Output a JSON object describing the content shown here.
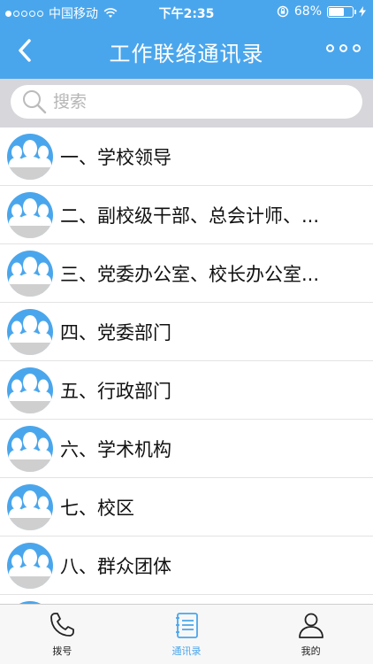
{
  "status_bar": {
    "carrier": "中国移动",
    "time": "下午2:35",
    "battery_text": "68%",
    "battery_level": 0.68
  },
  "nav": {
    "title": "工作联络通讯录"
  },
  "search": {
    "placeholder": "搜索"
  },
  "list": {
    "items": [
      {
        "label": "一、学校领导"
      },
      {
        "label": "二、副校级干部、总会计师、..."
      },
      {
        "label": "三、党委办公室、校长办公室..."
      },
      {
        "label": "四、党委部门"
      },
      {
        "label": "五、行政部门"
      },
      {
        "label": "六、学术机构"
      },
      {
        "label": "七、校区"
      },
      {
        "label": "八、群众团体"
      },
      {
        "label": ""
      }
    ]
  },
  "tabbar": {
    "tabs": [
      {
        "label": "拨号",
        "icon": "phone-icon",
        "active": false
      },
      {
        "label": "通讯录",
        "icon": "contacts-book-icon",
        "active": true
      },
      {
        "label": "我的",
        "icon": "person-icon",
        "active": false
      }
    ]
  },
  "colors": {
    "accent": "#4aa6ec",
    "search_bg": "#d6d6db",
    "avatar_bg": "#4aa6ec",
    "tab_active": "#4aa6ec"
  }
}
